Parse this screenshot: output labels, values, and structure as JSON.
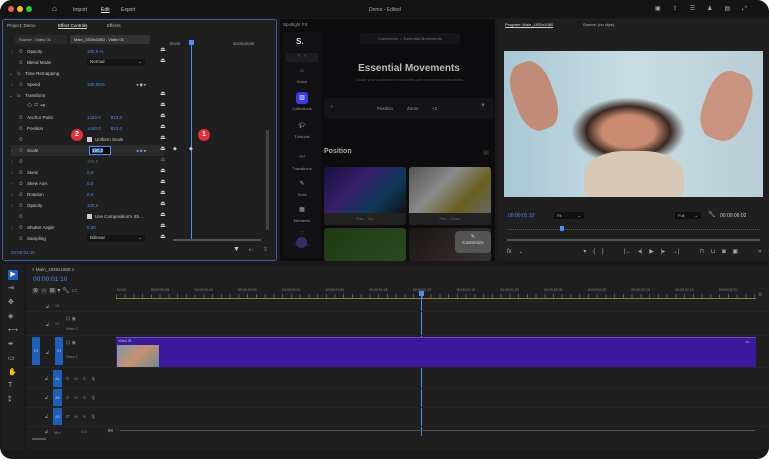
{
  "topbar": {
    "nav": [
      "Import",
      "Edit",
      "Export"
    ],
    "active": "Edit",
    "title": "Demo - Edited",
    "icons": [
      "home-icon",
      "quick-export-icon",
      "share-icon",
      "workspaces-icon",
      "user-icon",
      "comments-icon",
      "fullscreen-icon"
    ]
  },
  "left_panel": {
    "tabs": [
      "Project: Demo",
      "Effect Controls",
      "Effects"
    ],
    "active_tab": "Effect Controls",
    "source_tab": "Source - Video 01",
    "sequence_tab": "Main_1920x1080 - Video 01",
    "ruler": [
      "00;00",
      "00;00;05;00"
    ],
    "rows": [
      {
        "label": "Opacity",
        "value": "100,0 %",
        "chev": true
      },
      {
        "label": "Blend Mode",
        "value": "Normal",
        "dropdown": true
      },
      {
        "label": "Time Remapping",
        "section": true
      },
      {
        "label": "Speed",
        "value": "100,00%",
        "chev": true,
        "keyframes": true
      },
      {
        "label": "Transform",
        "section": true
      },
      {
        "label": "",
        "shapes": true
      },
      {
        "label": "Anchor Point",
        "value": "1440,0",
        "value2": "810,0"
      },
      {
        "label": "Position",
        "value": "1440,0",
        "value2": "810,0"
      },
      {
        "label": "",
        "checkbox": "Uniform Scale"
      },
      {
        "label": "Scale",
        "value": "190,0",
        "chev": true,
        "editing": true,
        "keyframes": true
      },
      {
        "label": "",
        "value": "100,0",
        "disabled": true,
        "chev": true
      },
      {
        "label": "Skew",
        "value": "0,0",
        "chev": true
      },
      {
        "label": "Skew Axis",
        "value": "0,0",
        "chev": true
      },
      {
        "label": "Rotation",
        "value": "0,0",
        "chev": true
      },
      {
        "label": "Opacity",
        "value": "100,0",
        "chev": true
      },
      {
        "label": "",
        "checkbox": "Use Composition's Sh..."
      },
      {
        "label": "Shutter Angle",
        "value": "0,00",
        "chev": true
      },
      {
        "label": "Sampling",
        "value": "Bilinear",
        "dropdown": true
      }
    ],
    "badges": [
      "1",
      "2"
    ],
    "badge_color": "#e0303a",
    "timecode": "00:00:01:10"
  },
  "spotlight": {
    "tab": "Spotlight FX",
    "logo": "S.",
    "breadcrumb": [
      "Collections",
      "Essential Movements"
    ],
    "title": "Essential Movements",
    "subtitle": "Guide your audience's focus with core movement animations.",
    "nav": [
      "Home",
      "Collections",
      "Tutorials",
      "Transitions",
      "Texts",
      "Elements",
      "Overlays"
    ],
    "active_nav": "Collections",
    "filters": [
      "Position",
      "Zoom",
      "+2"
    ],
    "section": "Position",
    "section_count": "4",
    "cards": [
      "Pan - Top",
      "Pan - Down"
    ],
    "customize": "Customize"
  },
  "program": {
    "tabs": [
      "Program: Main_1920x1080",
      "Source: (no clips)"
    ],
    "timecode": "00:00:01:10",
    "fit": "Fit",
    "quality": "Full",
    "duration": "00:00:06:02"
  },
  "timeline": {
    "sequence": "Main_1920x1080",
    "timecode": "00:00:01:10",
    "ruler": [
      "00:00",
      "00:00:00:05",
      "00:00:00:10",
      "00:00:00:15",
      "00:00:00:20",
      "00:00:01:00",
      "00:00:01:05",
      "00:00:01:10",
      "00:00:01:15",
      "00:00:01:20",
      "00:00:02:00",
      "00:00:02:05",
      "00:00:02:10",
      "00:00:02:15",
      "00:00:02:20"
    ],
    "video_tracks": [
      {
        "id": "V3",
        "name": ""
      },
      {
        "id": "V2",
        "name": "Video 2"
      },
      {
        "id": "V1",
        "name": "Video 1",
        "src": "V1"
      }
    ],
    "audio_tracks": [
      "A1",
      "A2",
      "A3"
    ],
    "mix": "Mix",
    "mix_value": "0,0",
    "clip": "Video 01",
    "clip_color": "#3a1a9a",
    "accent": "#4c8ee8"
  }
}
